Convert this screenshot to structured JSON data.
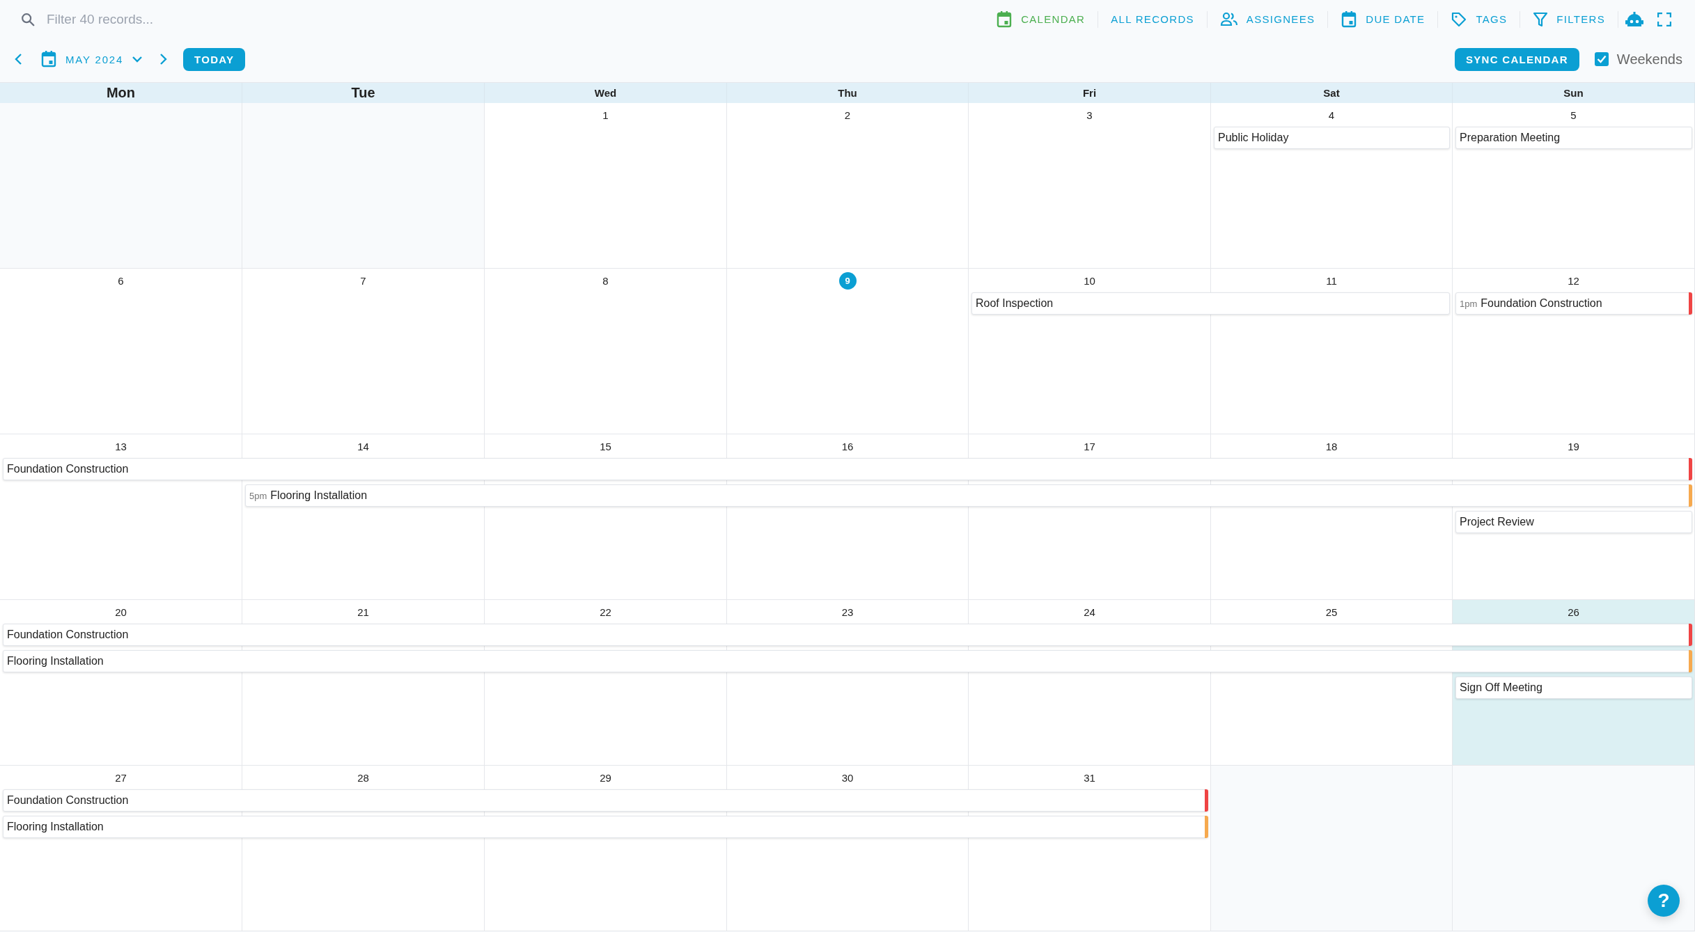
{
  "search": {
    "placeholder": "Filter 40 records..."
  },
  "toolbar_items": [
    {
      "label": "CALENDAR",
      "kind": "calendar",
      "selected": true
    },
    {
      "label": "ALL RECORDS",
      "kind": "text",
      "selected": false
    },
    {
      "label": "ASSIGNEES",
      "kind": "people",
      "selected": false
    },
    {
      "label": "DUE DATE",
      "kind": "calendar",
      "selected": false
    },
    {
      "label": "TAGS",
      "kind": "tag",
      "selected": false
    },
    {
      "label": "FILTERS",
      "kind": "filter",
      "selected": false
    }
  ],
  "navigation": {
    "month": "MAY 2024",
    "today_button": "TODAY"
  },
  "sync_button": "SYNC CALENDAR",
  "weekends": {
    "label": "Weekends",
    "checked": true
  },
  "weekdays": [
    {
      "label": "Mon",
      "large": true
    },
    {
      "label": "Tue",
      "large": true
    },
    {
      "label": "Wed",
      "large": false
    },
    {
      "label": "Thu",
      "large": false
    },
    {
      "label": "Fri",
      "large": false
    },
    {
      "label": "Sat",
      "large": false
    },
    {
      "label": "Sun",
      "large": false
    }
  ],
  "weeks": [
    {
      "days": [
        {
          "kind": "blank"
        },
        {
          "kind": "blank"
        },
        {
          "kind": "day",
          "date": "1",
          "today": false,
          "highlighted": false
        },
        {
          "kind": "day",
          "date": "2",
          "today": false,
          "highlighted": false
        },
        {
          "kind": "day",
          "date": "3",
          "today": false,
          "highlighted": false
        },
        {
          "kind": "day",
          "date": "4",
          "today": false,
          "highlighted": false,
          "events": [
            {
              "kind": "event",
              "title": "Public Holiday"
            }
          ]
        },
        {
          "kind": "day",
          "date": "5",
          "today": false,
          "highlighted": false,
          "events": [
            {
              "kind": "event",
              "title": "Preparation Meeting"
            }
          ]
        }
      ]
    },
    {
      "days": [
        {
          "kind": "day",
          "date": "6",
          "today": false,
          "highlighted": false
        },
        {
          "kind": "day",
          "date": "7",
          "today": false,
          "highlighted": false
        },
        {
          "kind": "day",
          "date": "8",
          "today": false,
          "highlighted": false
        },
        {
          "kind": "day",
          "date": "9",
          "today": true,
          "highlighted": false
        },
        {
          "kind": "day",
          "date": "10",
          "today": false,
          "highlighted": false,
          "events": [
            {
              "kind": "event",
              "title": "Roof Inspection"
            }
          ]
        },
        {
          "kind": "day",
          "date": "11",
          "today": false,
          "highlighted": false,
          "events": [
            {
              "kind": "continuation"
            }
          ]
        },
        {
          "kind": "day",
          "date": "12",
          "today": false,
          "highlighted": false,
          "events": [
            {
              "kind": "event",
              "title": "Foundation Construction",
              "time": "1pm",
              "color": "#ef4444"
            }
          ]
        }
      ]
    },
    {
      "days": [
        {
          "kind": "day",
          "date": "13",
          "today": false,
          "highlighted": false,
          "events": [
            {
              "kind": "event",
              "title": "Foundation Construction",
              "color": "#ef4444"
            }
          ]
        },
        {
          "kind": "day",
          "date": "14",
          "today": false,
          "highlighted": false,
          "events": [
            {
              "kind": "continuation"
            },
            {
              "kind": "event",
              "title": "Flooring Installation",
              "time": "5pm",
              "color": "#f6a94e"
            }
          ]
        },
        {
          "kind": "day",
          "date": "15",
          "today": false,
          "highlighted": false,
          "events": [
            {
              "kind": "continuation"
            },
            {
              "kind": "continuation"
            }
          ]
        },
        {
          "kind": "day",
          "date": "16",
          "today": false,
          "highlighted": false,
          "events": [
            {
              "kind": "continuation"
            },
            {
              "kind": "continuation"
            }
          ]
        },
        {
          "kind": "day",
          "date": "17",
          "today": false,
          "highlighted": false,
          "events": [
            {
              "kind": "continuation"
            },
            {
              "kind": "continuation"
            }
          ]
        },
        {
          "kind": "day",
          "date": "18",
          "today": false,
          "highlighted": false,
          "events": [
            {
              "kind": "continuation"
            },
            {
              "kind": "continuation"
            }
          ]
        },
        {
          "kind": "day",
          "date": "19",
          "today": false,
          "highlighted": false,
          "events": [
            {
              "kind": "continuation"
            },
            {
              "kind": "continuation"
            },
            {
              "kind": "event",
              "title": "Project Review"
            }
          ]
        }
      ]
    },
    {
      "days": [
        {
          "kind": "day",
          "date": "20",
          "today": false,
          "highlighted": false,
          "events": [
            {
              "kind": "event",
              "title": "Foundation Construction",
              "color": "#ef4444"
            },
            {
              "kind": "event",
              "title": "Flooring Installation",
              "color": "#f6a94e"
            }
          ]
        },
        {
          "kind": "day",
          "date": "21",
          "today": false,
          "highlighted": false,
          "events": [
            {
              "kind": "continuation"
            },
            {
              "kind": "continuation"
            }
          ]
        },
        {
          "kind": "day",
          "date": "22",
          "today": false,
          "highlighted": false,
          "events": [
            {
              "kind": "continuation"
            },
            {
              "kind": "continuation"
            }
          ]
        },
        {
          "kind": "day",
          "date": "23",
          "today": false,
          "highlighted": false,
          "events": [
            {
              "kind": "continuation"
            },
            {
              "kind": "continuation"
            }
          ]
        },
        {
          "kind": "day",
          "date": "24",
          "today": false,
          "highlighted": false,
          "events": [
            {
              "kind": "continuation"
            },
            {
              "kind": "continuation"
            }
          ]
        },
        {
          "kind": "day",
          "date": "25",
          "today": false,
          "highlighted": false,
          "events": [
            {
              "kind": "continuation"
            },
            {
              "kind": "continuation"
            }
          ]
        },
        {
          "kind": "day",
          "date": "26",
          "today": false,
          "highlighted": true,
          "events": [
            {
              "kind": "continuation"
            },
            {
              "kind": "continuation"
            },
            {
              "kind": "event",
              "title": "Sign Off Meeting"
            }
          ]
        }
      ]
    },
    {
      "days": [
        {
          "kind": "day",
          "date": "27",
          "today": false,
          "highlighted": false,
          "events": [
            {
              "kind": "event",
              "title": "Foundation Construction",
              "color": "#ef4444"
            },
            {
              "kind": "event",
              "title": "Flooring Installation",
              "color": "#f6a94e"
            }
          ]
        },
        {
          "kind": "day",
          "date": "28",
          "today": false,
          "highlighted": false,
          "events": [
            {
              "kind": "continuation"
            },
            {
              "kind": "continuation"
            }
          ]
        },
        {
          "kind": "day",
          "date": "29",
          "today": false,
          "highlighted": false,
          "events": [
            {
              "kind": "continuation"
            },
            {
              "kind": "continuation"
            }
          ]
        },
        {
          "kind": "day",
          "date": "30",
          "today": false,
          "highlighted": false,
          "events": [
            {
              "kind": "continuation"
            },
            {
              "kind": "continuation"
            }
          ]
        },
        {
          "kind": "day",
          "date": "31",
          "today": false,
          "highlighted": false,
          "events": [
            {
              "kind": "continuation"
            },
            {
              "kind": "continuation"
            }
          ]
        },
        {
          "kind": "blank"
        },
        {
          "kind": "blank"
        }
      ]
    }
  ],
  "help_button": "?"
}
